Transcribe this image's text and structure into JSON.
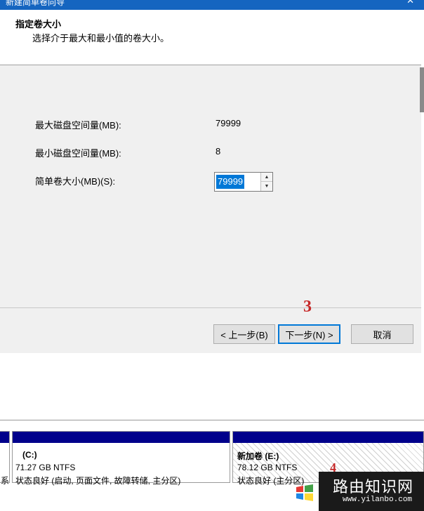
{
  "window": {
    "title": "新建简单卷向导"
  },
  "header": {
    "title": "指定卷大小",
    "subtitle": "选择介于最大和最小值的卷大小。"
  },
  "fields": {
    "max_label": "最大磁盘空间量(MB):",
    "max_value": "79999",
    "min_label": "最小磁盘空间量(MB):",
    "min_value": "8",
    "size_label": "简单卷大小(MB)(S):",
    "size_value": "79999"
  },
  "buttons": {
    "back": "< 上一步(B)",
    "next": "下一步(N) >",
    "cancel": "取消"
  },
  "annotations": {
    "step3": "3",
    "step4": "4"
  },
  "disk": {
    "volumes": [
      {
        "name": "(C:)",
        "size": "71.27 GB NTFS",
        "status": "状态良好 (启动, 页面文件, 故障转储, 主分区)"
      },
      {
        "name": "新加卷 (E:)",
        "size": "78.12 GB NTFS",
        "status": "状态良好 (主分区)"
      }
    ],
    "left_fragment": "系"
  },
  "watermark": {
    "title": "路由知识网",
    "url": "www.yilanbo.com"
  },
  "colors": {
    "accent": "#0078d7",
    "volume_bar": "#00008b",
    "annotation": "#c62828"
  }
}
